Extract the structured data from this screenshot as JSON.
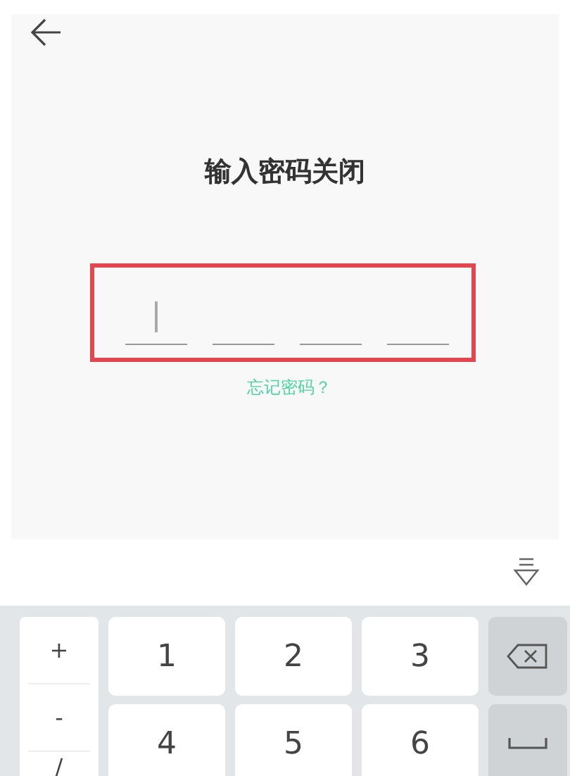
{
  "title": "输入密码关闭",
  "pin_slots": [
    {
      "focused": true
    },
    {
      "focused": false
    },
    {
      "focused": false
    },
    {
      "focused": false
    }
  ],
  "forgot_link": "忘记密码？",
  "keyboard": {
    "symbol_keys": [
      "+",
      "-",
      "/"
    ],
    "digit_keys": [
      "1",
      "2",
      "3",
      "4",
      "5",
      "6"
    ]
  }
}
